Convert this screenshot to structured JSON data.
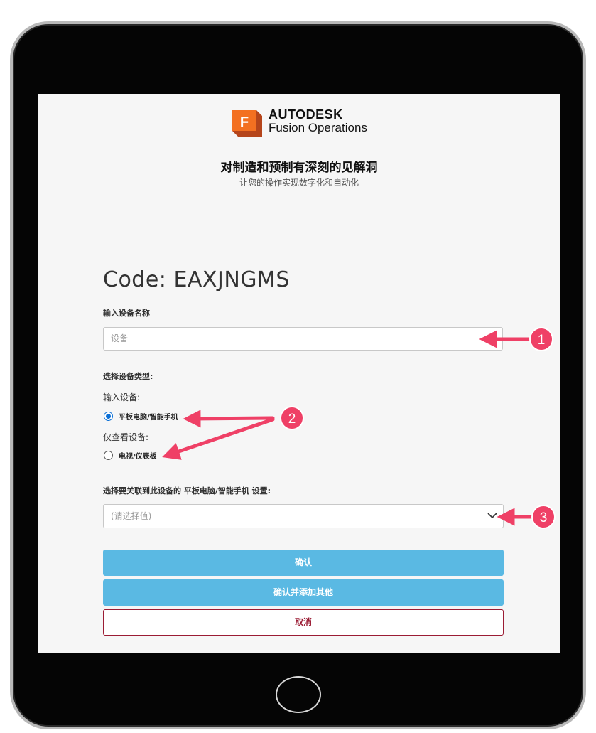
{
  "header": {
    "logo_brand": "AUTODESK",
    "logo_product": "Fusion Operations",
    "logo_letter": "F",
    "headline": "对制造和预制有深刻的见解洞",
    "subheadline": "让您的操作实现数字化和自动化"
  },
  "form": {
    "code_title": "Code: EAXJNGMS",
    "device_name_label": "输入设备名称",
    "device_name_placeholder": "设备",
    "device_type_label": "选择设备类型:",
    "input_device_label": "输入设备:",
    "option_tablet": "平板电脑/智能手机",
    "option_tablet_selected": true,
    "view_only_label": "仅查看设备:",
    "option_tv": "电视/仪表板",
    "option_tv_selected": false,
    "settings_label": "选择要关联到此设备的 平板电脑/智能手机 设置:",
    "settings_placeholder": "(请选择值)"
  },
  "buttons": {
    "confirm": "确认",
    "confirm_add_more": "确认并添加其他",
    "cancel": "取消"
  },
  "annotations": {
    "badge_1": "1",
    "badge_2": "2",
    "badge_3": "3"
  },
  "colors": {
    "accent_blue": "#5ab9e3",
    "cancel_red": "#9b1c34",
    "annotation_pink": "#ef4066",
    "logo_orange": "#f37021"
  }
}
